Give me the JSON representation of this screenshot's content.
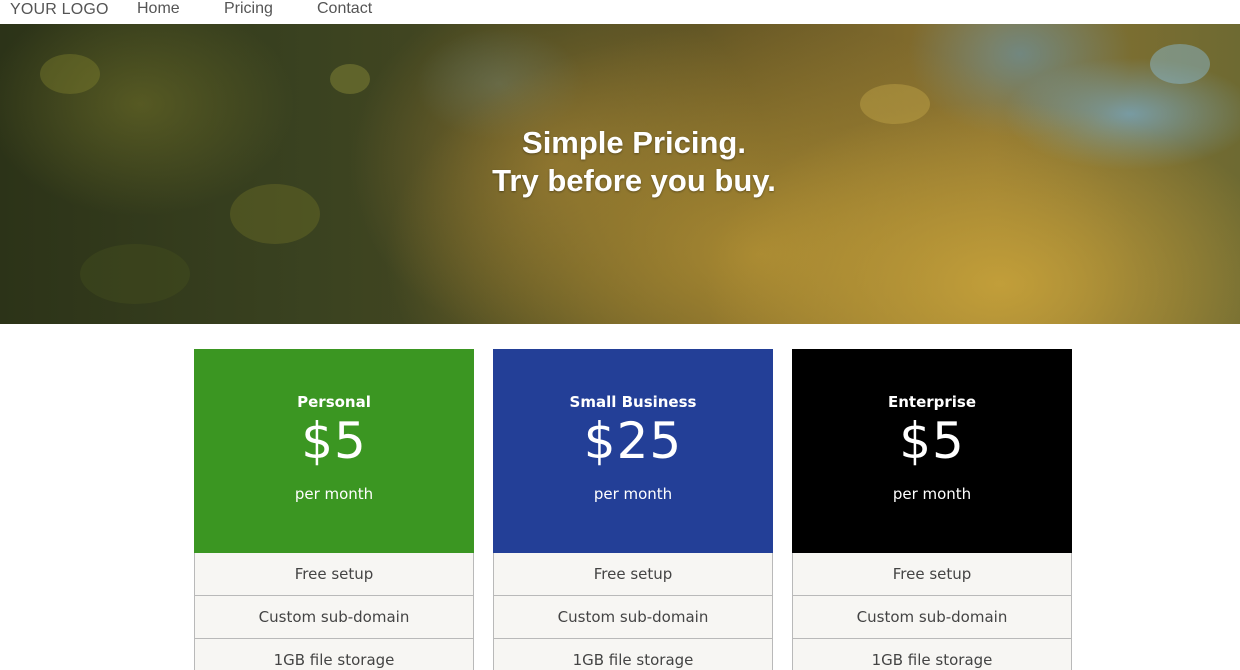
{
  "nav": {
    "logo": "YOUR LOGO",
    "links": [
      "Home",
      "Pricing",
      "Contact"
    ]
  },
  "hero": {
    "line1": "Simple Pricing.",
    "line2": "Try before you buy."
  },
  "plans": [
    {
      "name": "Personal",
      "price": "$5",
      "period": "per month",
      "color": "#3b9622",
      "features": [
        "Free setup",
        "Custom sub-domain",
        "1GB file storage"
      ]
    },
    {
      "name": "Small Business",
      "price": "$25",
      "period": "per month",
      "color": "#233f97",
      "features": [
        "Free setup",
        "Custom sub-domain",
        "1GB file storage"
      ]
    },
    {
      "name": "Enterprise",
      "price": "$5",
      "period": "per month",
      "color": "#000000",
      "features": [
        "Free setup",
        "Custom sub-domain",
        "1GB file storage"
      ]
    }
  ]
}
